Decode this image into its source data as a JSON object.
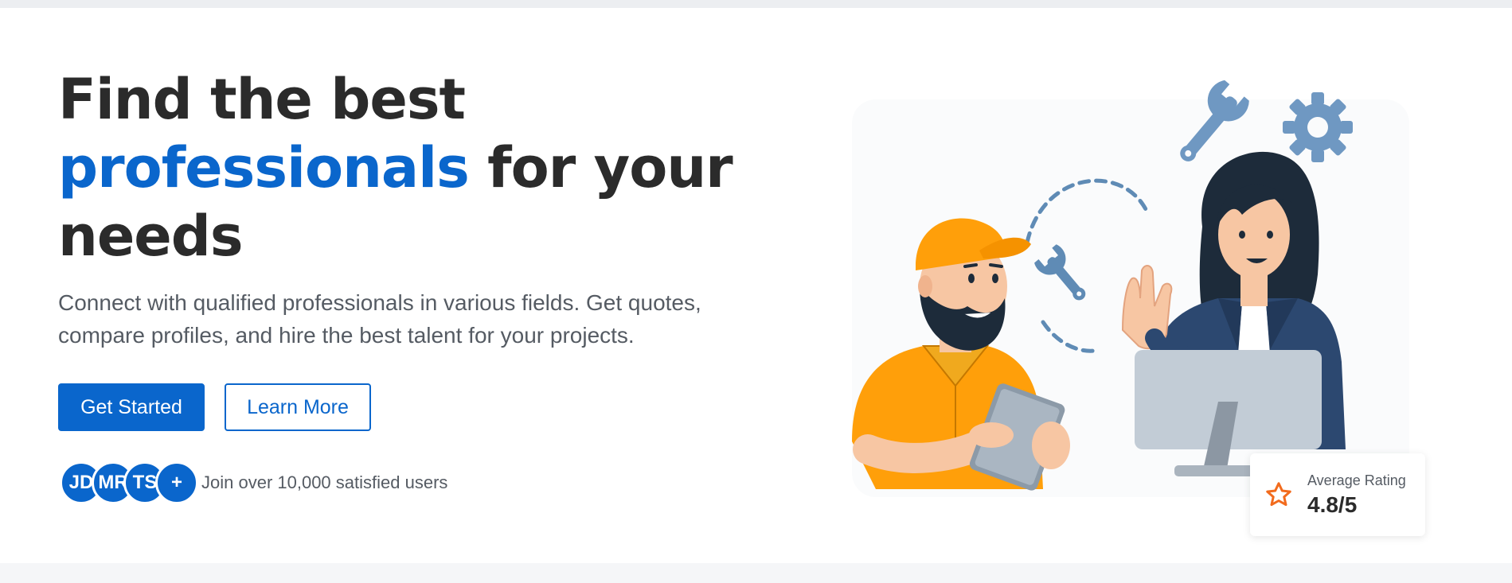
{
  "hero": {
    "title_part1": "Find the best",
    "title_accent": "professionals",
    "title_part2": " for your needs",
    "subtitle": "Connect with qualified professionals in various fields. Get quotes, compare profiles, and hire the best talent for your projects."
  },
  "cta": {
    "primary_label": "Get Started",
    "secondary_label": "Learn More"
  },
  "social_proof": {
    "avatars": [
      "JD",
      "MR",
      "TS",
      "+"
    ],
    "text": "Join over 10,000 satisfied users"
  },
  "rating": {
    "label": "Average Rating",
    "value": "4.8/5",
    "icon": "star-icon"
  },
  "colors": {
    "accent": "#0a66cc",
    "text": "#2b2b2b",
    "muted": "#555b63",
    "star": "#f26b1d"
  },
  "illustration": {
    "icons": [
      "wrench-icon",
      "gear-icon",
      "small-wrench-icon"
    ],
    "figures": [
      "worker-with-tablet",
      "woman-waving",
      "computer-monitor"
    ]
  }
}
